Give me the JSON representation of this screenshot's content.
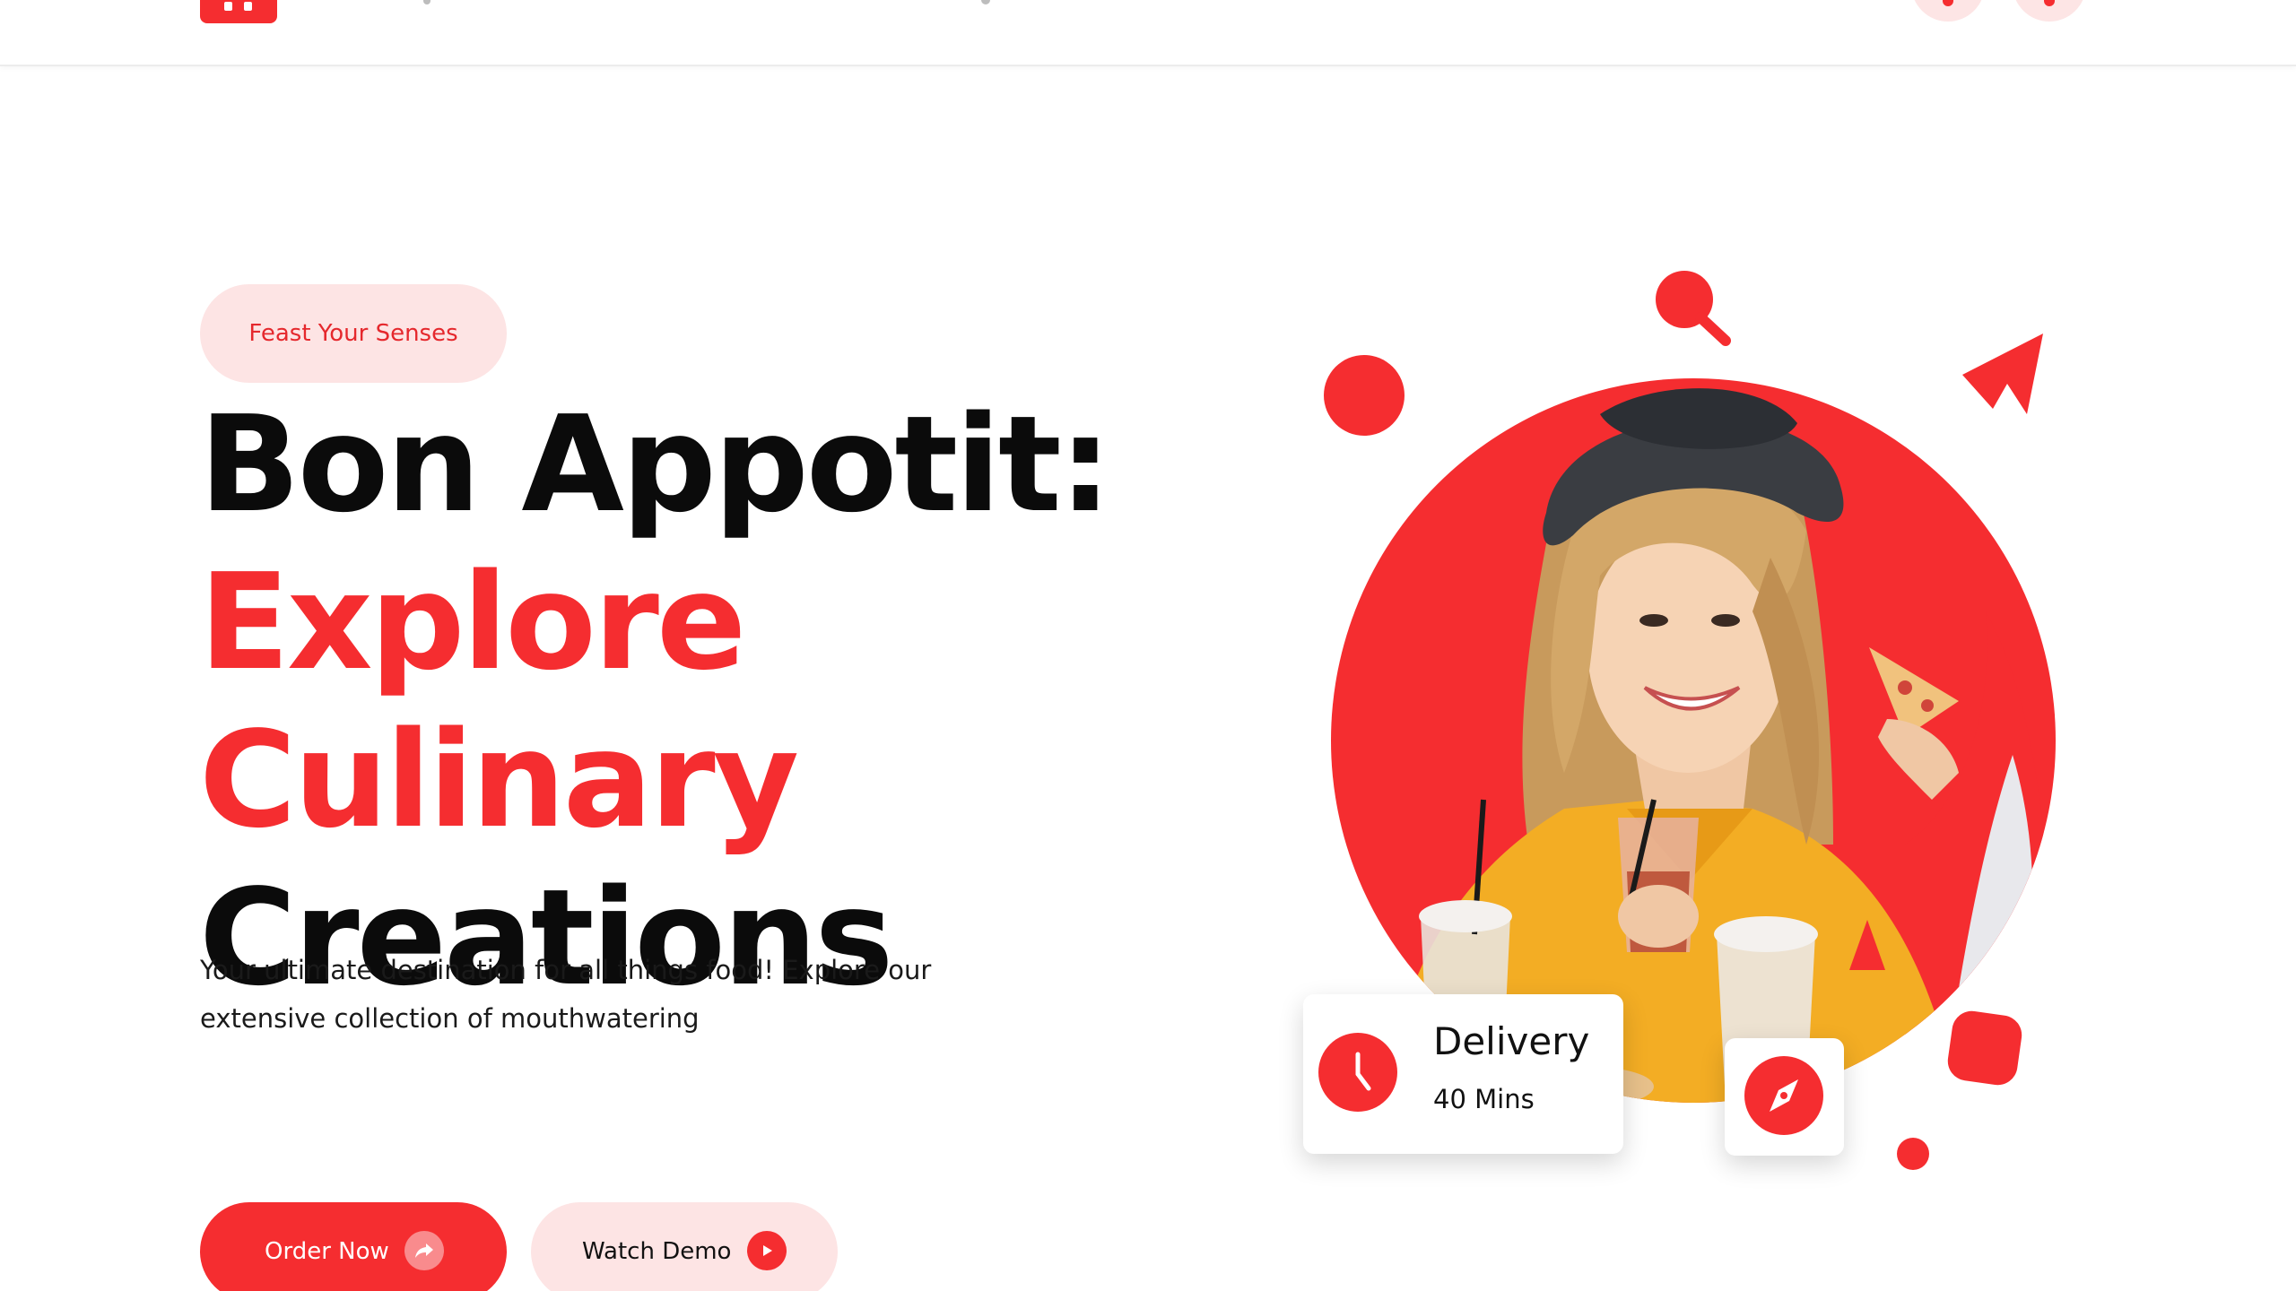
{
  "header": {
    "logo_icon": "restaurant-logo-icon",
    "phone_icon": "phone-icon",
    "cart_icon": "cart-icon"
  },
  "hero": {
    "badge": "Feast Your Senses",
    "headline_line1": "Bon Appotit:",
    "headline_line2": "Explore Culinary",
    "headline_line3": "Creations",
    "description": "Your ultimate destination for all things food! Explore our extensive collection of mouthwatering",
    "order_button": "Order Now",
    "demo_button": "Watch Demo",
    "order_icon": "share-arrow-icon",
    "demo_icon": "play-icon"
  },
  "delivery_card": {
    "title": "Delivery",
    "time": "40 Mins",
    "icon": "clock-icon"
  },
  "compass_card": {
    "icon": "compass-icon"
  },
  "colors": {
    "accent": "#f52d30",
    "accent_soft": "#fde4e4",
    "text": "#0b0b0b"
  }
}
